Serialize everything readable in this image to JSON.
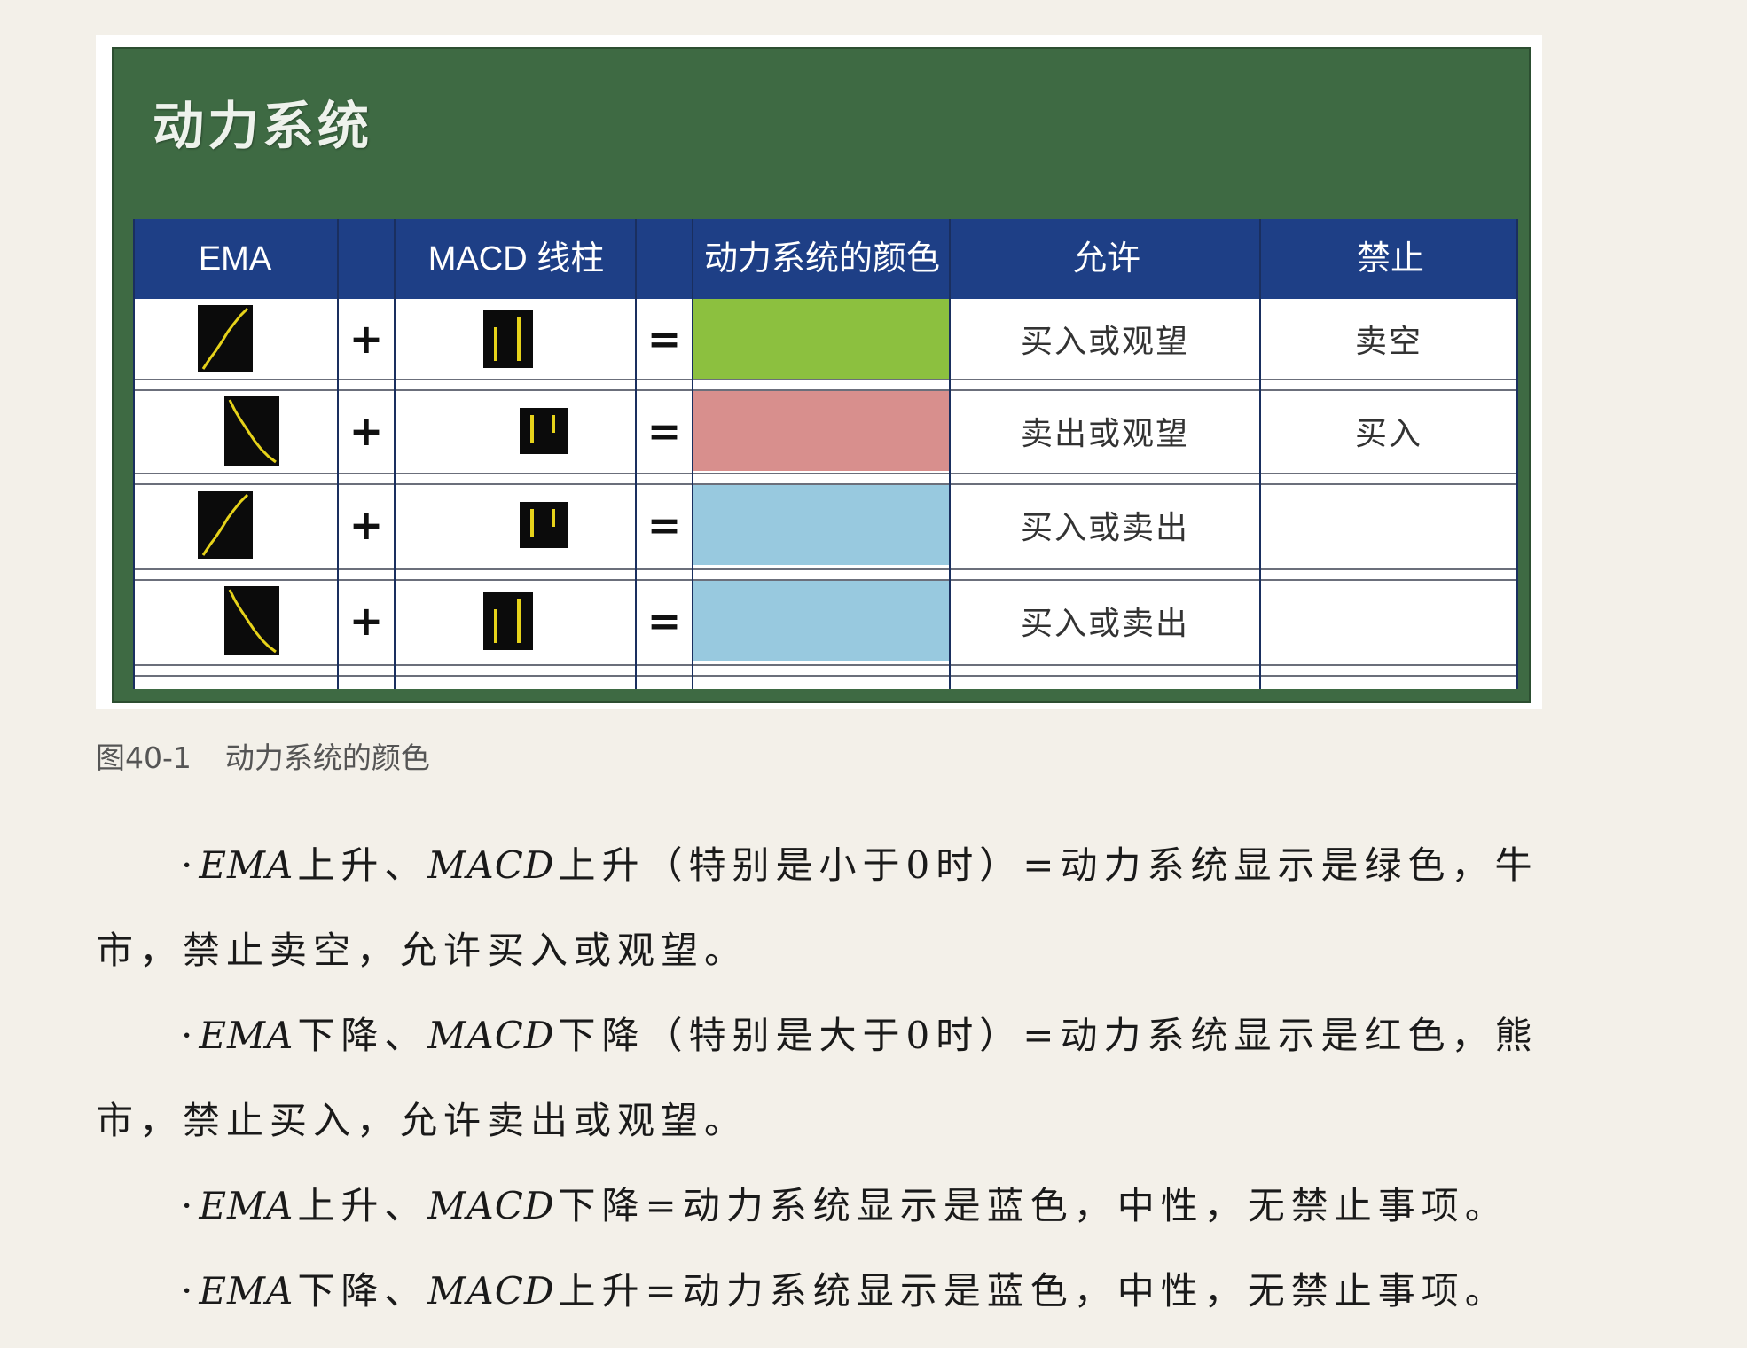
{
  "figure": {
    "title": "动力系统",
    "headers": {
      "ema": "EMA",
      "macd": "MACD 线柱",
      "color": "动力系统的颜色",
      "allow": "允许",
      "forbid": "禁止"
    },
    "plus": "+",
    "equals": "=",
    "rows": [
      {
        "ema_trend": "up",
        "macd_trend": "up",
        "color": "#8cc03f",
        "allow": "买入或观望",
        "forbid": "卖空"
      },
      {
        "ema_trend": "down",
        "macd_trend": "down",
        "color": "#d88f8d",
        "allow": "卖出或观望",
        "forbid": "买入"
      },
      {
        "ema_trend": "up",
        "macd_trend": "down",
        "color": "#98c9df",
        "allow": "买入或卖出",
        "forbid": ""
      },
      {
        "ema_trend": "down",
        "macd_trend": "up",
        "color": "#98c9df",
        "allow": "买入或卖出",
        "forbid": ""
      }
    ]
  },
  "caption": {
    "number": "图40-1",
    "text": "动力系统的颜色"
  },
  "bullets": [
    {
      "line1_pre": "·",
      "line1_italic_1": "EMA",
      "line1_mid_1": "上升、",
      "line1_italic_2": "MACD",
      "line1_rest": "上升（特别是小于0时）=动力系统显示是绿色，牛",
      "line2": "市，禁止卖空，允许买入或观望。"
    },
    {
      "line1_pre": "·",
      "line1_italic_1": "EMA",
      "line1_mid_1": "下降、",
      "line1_italic_2": "MACD",
      "line1_rest": "下降（特别是大于0时）=动力系统显示是红色，熊",
      "line2": "市，禁止买入，允许卖出或观望。"
    },
    {
      "line1_pre": "·",
      "line1_italic_1": "EMA",
      "line1_mid_1": "上升、",
      "line1_italic_2": "MACD",
      "line1_rest": "下降=动力系统显示是蓝色，中性，无禁止事项。"
    },
    {
      "line1_pre": "·",
      "line1_italic_1": "EMA",
      "line1_mid_1": "下降、",
      "line1_italic_2": "MACD",
      "line1_rest": "上升=动力系统显示是蓝色，中性，无禁止事项。"
    }
  ]
}
